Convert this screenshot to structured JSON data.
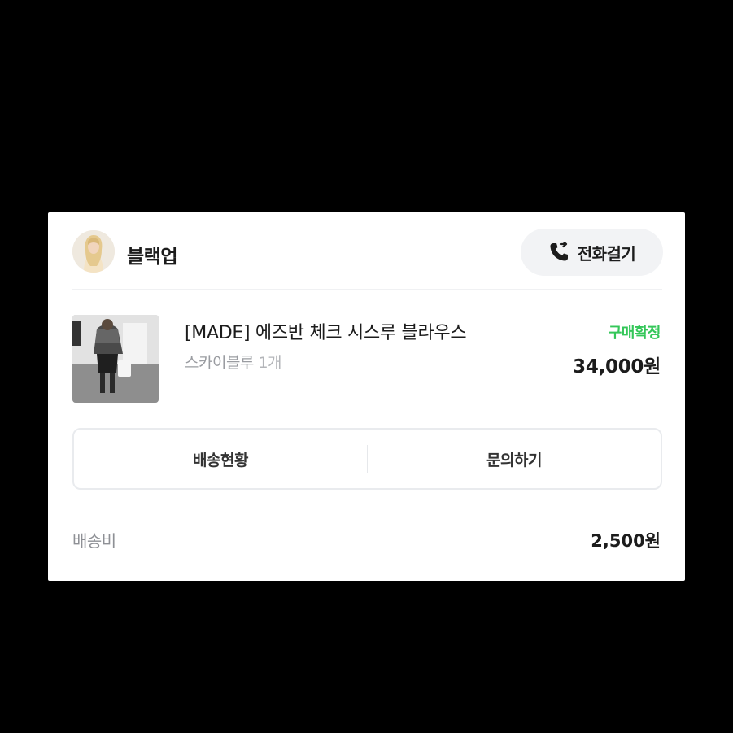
{
  "seller": {
    "name": "블랙업",
    "call_label": "전화걸기"
  },
  "product": {
    "title": "[MADE] 에즈반 체크 시스루 블라우스",
    "option": "스카이블루",
    "quantity": "1개",
    "status": "구매확정",
    "price": "34,000원"
  },
  "actions": {
    "shipping_status_label": "배송현황",
    "inquiry_label": "문의하기"
  },
  "shipping_fee": {
    "label": "배송비",
    "value": "2,500원"
  },
  "colors": {
    "status_green": "#34c759",
    "background": "#000000",
    "card": "#ffffff"
  },
  "icons": {
    "call": "phone-forward-icon"
  }
}
